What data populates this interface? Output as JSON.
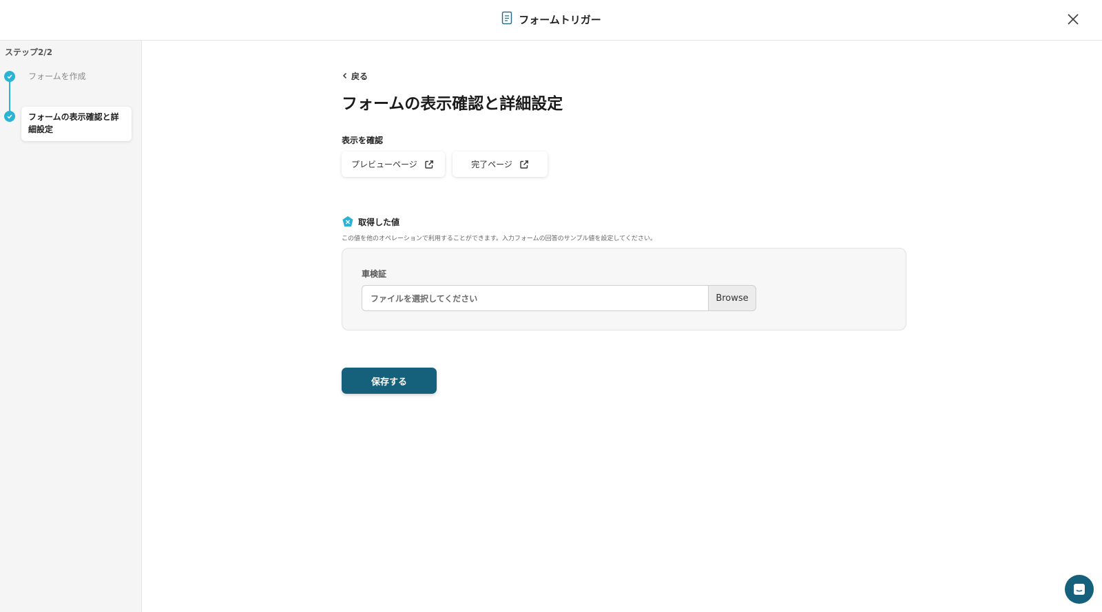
{
  "header": {
    "title": "フォームトリガー",
    "icon": "form-document-icon",
    "close_icon": "close-icon"
  },
  "sidebar": {
    "step_count": "ステップ2/2",
    "steps": [
      {
        "label": "フォームを作成",
        "status": "completed"
      },
      {
        "label": "フォームの表示確認と詳細設定",
        "status": "current"
      }
    ],
    "accent_color": "#2bb3d6"
  },
  "main": {
    "back_label": "戻る",
    "title": "フォームの表示確認と詳細設定",
    "display_section_label": "表示を確認",
    "links": [
      {
        "label": "プレビューページ",
        "icon": "external-link-icon"
      },
      {
        "label": "完了ページ",
        "icon": "external-link-icon"
      }
    ],
    "values": {
      "title": "取得した値",
      "description": "この値を他のオペレーションで利用することができます。入力フォームの回答のサンプル値を設定してください。",
      "field_label": "車検証",
      "file_placeholder": "ファイルを選択してください",
      "browse_label": "Browse"
    },
    "save_label": "保存する",
    "primary_color": "#15607a"
  },
  "chat": {
    "icon": "chat-icon"
  }
}
